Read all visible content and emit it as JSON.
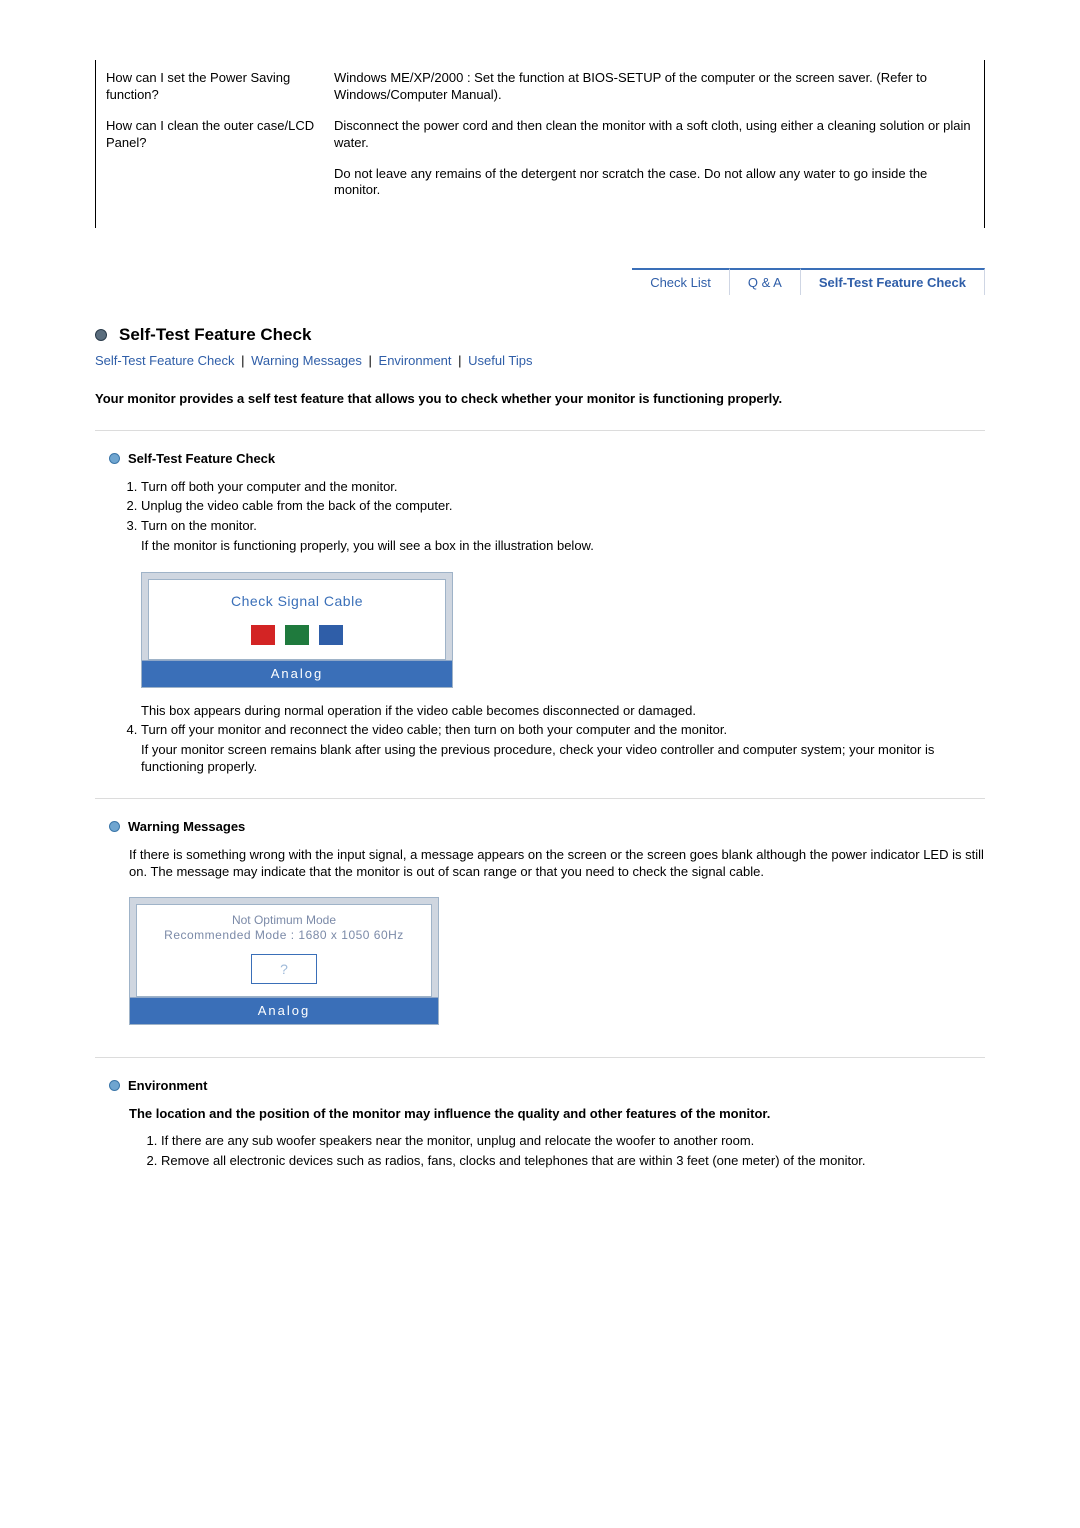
{
  "faq": [
    {
      "q": "How can I set the Power Saving function?",
      "a": [
        "Windows ME/XP/2000 : Set the function at BIOS-SETUP of the computer or the screen saver. (Refer to Windows/Computer Manual)."
      ]
    },
    {
      "q": "How can I clean the outer case/LCD Panel?",
      "a": [
        "Disconnect the power cord and then clean the monitor with a soft cloth, using either a cleaning solution or plain water.",
        "Do not leave any remains of the detergent nor scratch the case. Do not allow any water to go inside the monitor."
      ]
    }
  ],
  "tabs": {
    "check_list": "Check List",
    "qa": "Q & A",
    "self_test": "Self-Test Feature Check"
  },
  "title": "Self-Test Feature Check",
  "sub_links": {
    "self_test": "Self-Test Feature Check",
    "warning": "Warning Messages",
    "environment": "Environment",
    "useful_tips": "Useful Tips"
  },
  "intro": "Your monitor provides a self test feature that allows you to check whether your monitor is functioning properly.",
  "section_self_test": {
    "heading": "Self-Test Feature Check",
    "steps": {
      "s1": "Turn off both your computer and the monitor.",
      "s2": "Unplug the video cable from the back of the computer.",
      "s3a": "Turn on the monitor.",
      "s3b": "If the monitor is functioning properly, you will see a box in the illustration below.",
      "fig_msg": "Check Signal Cable",
      "fig_mode": "Analog",
      "after_fig": "This box appears during normal operation if the video cable becomes disconnected or damaged.",
      "s4a": "Turn off your monitor and reconnect the video cable; then turn on both your computer and the monitor.",
      "s4b": "If your monitor screen remains blank after using the previous procedure, check your video controller and computer system; your monitor is functioning properly."
    }
  },
  "section_warning": {
    "heading": "Warning Messages",
    "body": "If there is something wrong with the input signal, a message appears on the screen or the screen goes blank although the power indicator LED is still on. The message may indicate that the monitor is out of scan range or that you need to check the signal cable.",
    "fig_line1": "Not Optimum Mode",
    "fig_line2": "Recommended Mode : 1680 x 1050   60Hz",
    "fig_q": "?",
    "fig_mode": "Analog"
  },
  "section_env": {
    "heading": "Environment",
    "intro": "The location and the position of the monitor may influence the quality and other features of the monitor.",
    "items": {
      "i1": "If there are any sub woofer speakers near the monitor, unplug and relocate the woofer to another room.",
      "i2": "Remove all electronic devices such as radios, fans, clocks and telephones that are within 3 feet (one meter) of the monitor."
    }
  }
}
